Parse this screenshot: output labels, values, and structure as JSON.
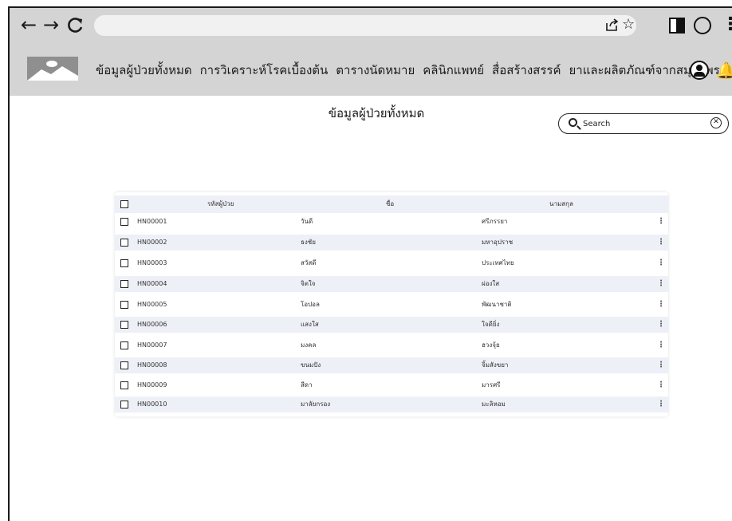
{
  "browser": {
    "icons": [
      "back-arrow-icon",
      "forward-arrow-icon",
      "reload-icon",
      "share-icon",
      "star-icon",
      "side-panel-icon",
      "profile-icon",
      "more-icon"
    ]
  },
  "header": {
    "nav": [
      {
        "label": "ข้อมูลผู้ป่วยทั้งหมด"
      },
      {
        "label": "การวิเคราะห์โรคเบื้องต้น"
      },
      {
        "label": "ตารางนัดหมาย"
      },
      {
        "label": "คลินิกแพทย์"
      },
      {
        "label": "สื่อสร้างสรรค์"
      },
      {
        "label": "ยาและผลิตภัณฑ์จากสมุนไพร"
      }
    ]
  },
  "main": {
    "title": "ข้อมูลผู้ป่วยทั้งหมด",
    "search": {
      "placeholder": "Search",
      "value": ""
    }
  },
  "table": {
    "columns": [
      "รหัสผู้ป่วย",
      "ชื่อ",
      "นามสกุล"
    ],
    "rows": [
      {
        "id": "HN00001",
        "first": "วันดี",
        "last": "ศรีภรรยา"
      },
      {
        "id": "HN00002",
        "first": "ธงชัย",
        "last": "มหาอุปราช"
      },
      {
        "id": "HN00003",
        "first": "สวัสดี",
        "last": "ประเทศไทย"
      },
      {
        "id": "HN00004",
        "first": "จิตใจ",
        "last": "ผ่องใส"
      },
      {
        "id": "HN00005",
        "first": "โอปอล",
        "last": "พัฒนาชาติ"
      },
      {
        "id": "HN00006",
        "first": "แสงใส",
        "last": "ใจดียิ่ง"
      },
      {
        "id": "HN00007",
        "first": "มงคล",
        "last": "ฮวงจุ้ย"
      },
      {
        "id": "HN00008",
        "first": "ขนมปัง",
        "last": "จิ้มสังขยา"
      },
      {
        "id": "HN00009",
        "first": "สีดา",
        "last": "มารศรี"
      },
      {
        "id": "HN00010",
        "first": "มาลัยกรอง",
        "last": "มะลิหอม"
      }
    ]
  },
  "colors": {
    "header_bg": "#d4d4d4",
    "stripe": "#eef0f7"
  }
}
